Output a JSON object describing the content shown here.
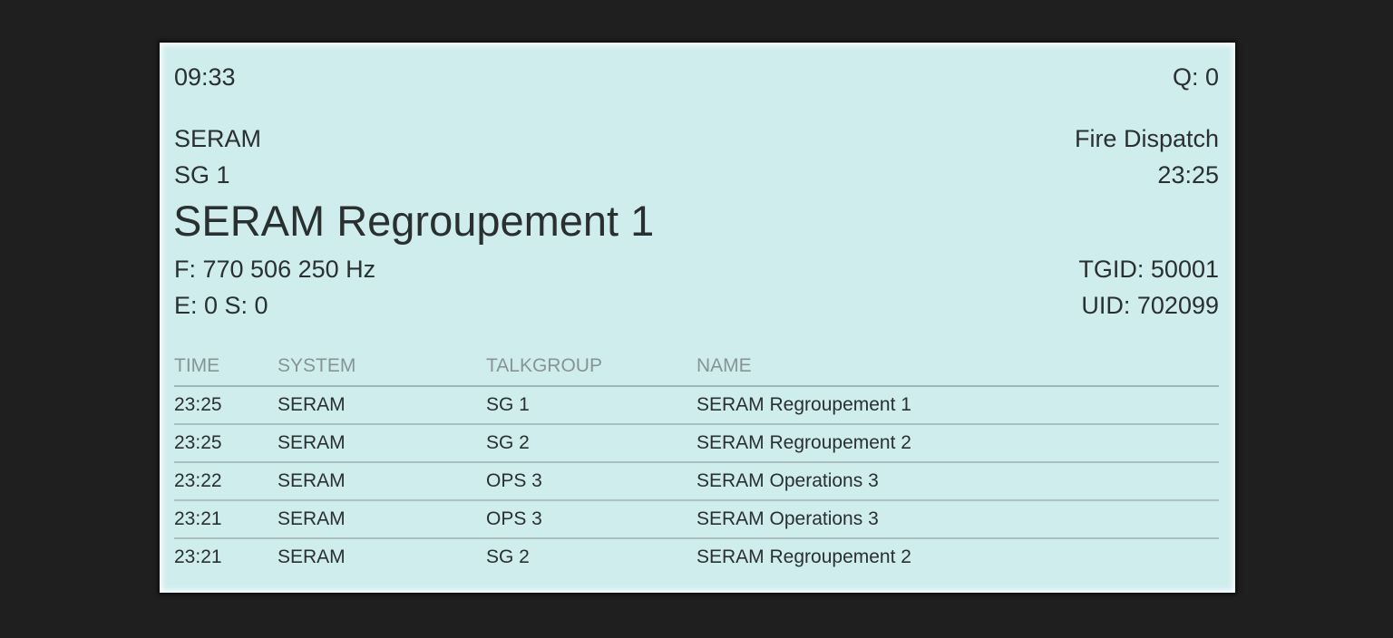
{
  "status": {
    "clock": "09:33",
    "queue": "Q: 0"
  },
  "current_call": {
    "system": "SERAM",
    "talkgroup_short": "SG 1",
    "talkgroup_name": "SERAM Regroupement 1",
    "frequency": "F: 770 506 250 Hz",
    "errors_spikes": "E: 0 S: 0",
    "tag": "Fire Dispatch",
    "call_time": "23:25",
    "tgid": "TGID: 50001",
    "uid": "UID: 702099"
  },
  "history": {
    "columns": [
      "TIME",
      "SYSTEM",
      "TALKGROUP",
      "NAME"
    ],
    "rows": [
      {
        "time": "23:25",
        "system": "SERAM",
        "talkgroup": "SG 1",
        "name": "SERAM Regroupement 1"
      },
      {
        "time": "23:25",
        "system": "SERAM",
        "talkgroup": "SG 2",
        "name": "SERAM Regroupement 2"
      },
      {
        "time": "23:22",
        "system": "SERAM",
        "talkgroup": "OPS 3",
        "name": "SERAM Operations 3"
      },
      {
        "time": "23:21",
        "system": "SERAM",
        "talkgroup": "OPS 3",
        "name": "SERAM Operations 3"
      },
      {
        "time": "23:21",
        "system": "SERAM",
        "talkgroup": "SG 2",
        "name": "SERAM Regroupement 2"
      }
    ]
  },
  "colors": {
    "background": "#1f1f1f",
    "screen": "#d0edee",
    "text": "#2a2f30",
    "header_text": "#879496"
  }
}
